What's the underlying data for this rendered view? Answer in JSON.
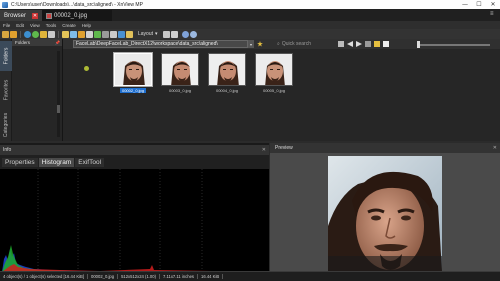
{
  "window": {
    "title": "C:\\Users\\user\\Downloads\\...\\data_src\\aligned\\ - XnView MP",
    "controls": [
      "—",
      "☐",
      "✕"
    ]
  },
  "tabs": [
    {
      "label": "Browser"
    },
    {
      "label": "00002_0.jpg"
    }
  ],
  "menu": [
    "File",
    "Edit",
    "View",
    "Tools",
    "Create",
    "Help"
  ],
  "toolbar": {
    "layout_label": "Layout",
    "colors": [
      "#d7a640",
      "#e0a02e",
      "#3c8fd0",
      "#5fb84c",
      "#e0b43a",
      "#c9c9c9",
      "#e4c458",
      "#7fbce8",
      "#e0a02e",
      "#d0d0d0",
      "#5fb84c",
      "#9a9a9a",
      "#c9c9c9",
      "#4a90d0",
      "#e2c15a",
      "#c9c9c9",
      "#d0d0d0",
      "#7fa2d8",
      "#9bb8e0"
    ]
  },
  "sidebar": {
    "tabs": [
      "Folders",
      "Favorites",
      "Categories"
    ]
  },
  "folders_panel": {
    "title": "Folders"
  },
  "address": {
    "path": "FaceLab\\DeepFaceLab_DirectX12\\workspace\\data_src\\aligned\\",
    "search_placeholder": "Quick search",
    "search_icon": "magnifier-icon"
  },
  "files": [
    {
      "name": "00002_0.jpg",
      "selected": true
    },
    {
      "name": "00003_0.jpg",
      "selected": false
    },
    {
      "name": "00004_0.jpg",
      "selected": false
    },
    {
      "name": "00005_0.jpg",
      "selected": false
    }
  ],
  "info_panel": {
    "title": "Info",
    "tabs": [
      "Properties",
      "Histogram",
      "ExifTool"
    ],
    "active_tab": "Histogram"
  },
  "preview_panel": {
    "title": "Preview"
  },
  "status": [
    "4 object(s) / 1 object(s) selected [16.44 KiB]",
    "00002_0.jpg",
    "512x512x24 (1.00)",
    "7.11x7.11 inches",
    "16.44 KiB"
  ]
}
